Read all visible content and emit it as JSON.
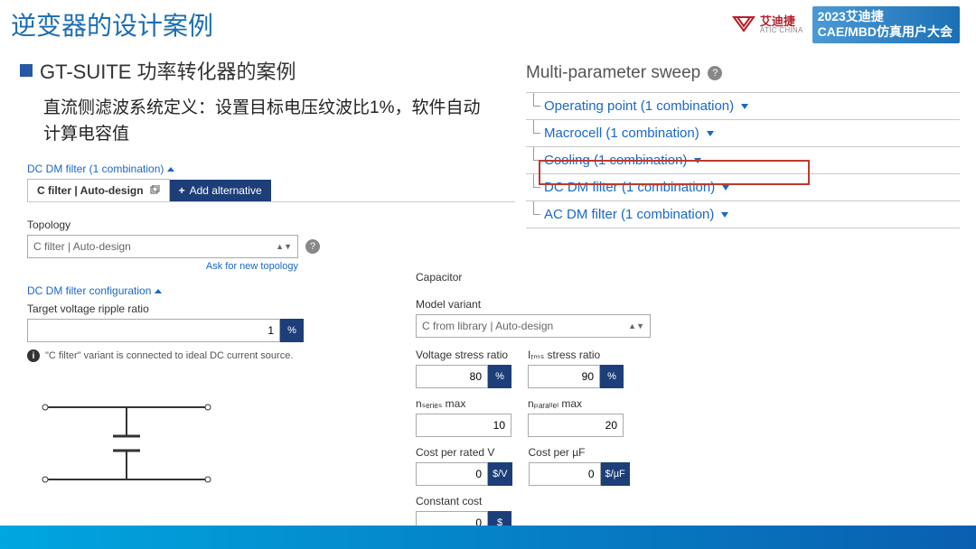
{
  "header": {
    "title": "逆变器的设计案例",
    "logo_cn": "艾迪捷",
    "logo_en": "ATIC CHINA",
    "conf_line1": "2023艾迪捷",
    "conf_line2": "CAE/MBD仿真用户大会"
  },
  "subtitle": "GT-SUITE 功率转化器的案例",
  "description": "直流侧滤波系统定义：设置目标电压纹波比1%，软件自动计算电容值",
  "sweep": {
    "title": "Multi-parameter sweep",
    "items": [
      {
        "label": "Operating point (1 combination)"
      },
      {
        "label": "Macrocell (1 combination)"
      },
      {
        "label": "Cooling (1 combination)"
      },
      {
        "label": "DC DM filter (1 combination)"
      },
      {
        "label": "AC DM filter (1 combination)"
      }
    ]
  },
  "form": {
    "crumb": "DC DM filter (1 combination)",
    "tab_label": "C filter | Auto-design",
    "add_alt": "Add alternative",
    "topology_lbl": "Topology",
    "topology_val": "C filter | Auto-design",
    "ask_link": "Ask for new topology",
    "config_hdr": "DC DM filter configuration",
    "ripple_lbl": "Target voltage ripple ratio",
    "ripple_val": "1",
    "ripple_unit": "%",
    "note": "\"C filter\" variant is connected to ideal DC current source.",
    "capacitor_hdr": "Capacitor",
    "model_lbl": "Model variant",
    "model_val": "C from library | Auto-design",
    "vstress_lbl": "Voltage stress ratio",
    "vstress_val": "80",
    "vstress_unit": "%",
    "istress_lbl": "Iᵣₘₛ stress ratio",
    "istress_val": "90",
    "istress_unit": "%",
    "nseries_lbl": "nₛₑᵣᵢₑₛ max",
    "nseries_val": "10",
    "npar_lbl": "nₚₐᵣₐₗₗₑₗ max",
    "npar_val": "20",
    "costv_lbl": "Cost per rated V",
    "costv_val": "0",
    "costv_unit": "$/V",
    "costuf_lbl": "Cost per µF",
    "costuf_val": "0",
    "costuf_unit": "$/µF",
    "constcost_lbl": "Constant cost",
    "constcost_val": "0",
    "constcost_unit": "$"
  }
}
